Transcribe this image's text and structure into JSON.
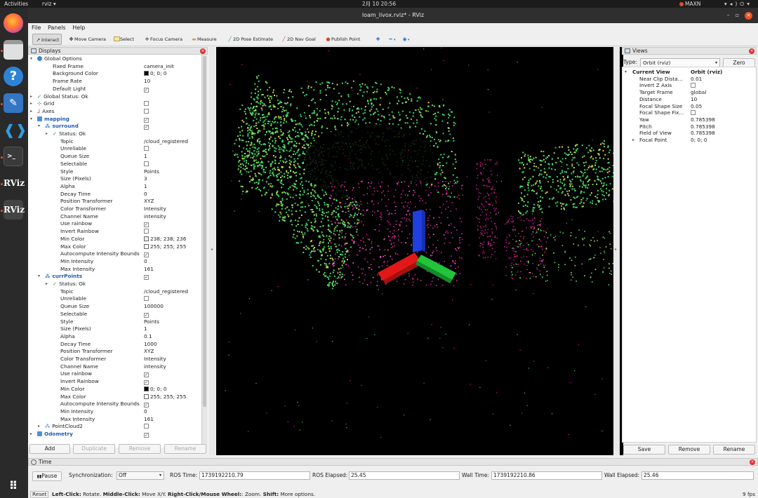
{
  "system": {
    "activities": "Activities",
    "app_menu": "rviz ▾",
    "clock": "2月 10  20:56",
    "power_mode": "MAXN",
    "tray_icons": [
      "wifi-icon",
      "volume-icon",
      "power-icon"
    ]
  },
  "dock": {
    "items": [
      "firefox-icon",
      "files-icon",
      "help-icon",
      "text-editor-icon",
      "vscode-icon",
      "terminal-icon",
      "rviz-icon",
      "rviz-icon",
      "show-apps-icon"
    ],
    "rviz_label": "RViz"
  },
  "window": {
    "title": "loam_livox.rviz* - RViz",
    "controls": [
      "minimize",
      "maximize",
      "close"
    ]
  },
  "menu": [
    "File",
    "Panels",
    "Help"
  ],
  "toolbar": [
    {
      "label": "Interact",
      "icon": "cursor-icon",
      "active": true
    },
    {
      "label": "Move Camera",
      "icon": "move-camera-icon"
    },
    {
      "label": "Select",
      "icon": "select-icon"
    },
    {
      "label": "Focus Camera",
      "icon": "focus-camera-icon"
    },
    {
      "label": "Measure",
      "icon": "measure-icon"
    },
    {
      "label": "2D Pose Estimate",
      "icon": "pose-arrow-icon"
    },
    {
      "label": "2D Nav Goal",
      "icon": "nav-goal-icon"
    },
    {
      "label": "Publish Point",
      "icon": "publish-point-icon"
    },
    {
      "label": "",
      "icon": "plus-icon"
    },
    {
      "label": "",
      "icon": "minus-icon"
    },
    {
      "label": "",
      "icon": "eye-icon"
    }
  ],
  "displays": {
    "title": "Displays",
    "rows": [
      {
        "name": "Global Options",
        "value": "",
        "lvl": 0,
        "arrow": "open",
        "icon": "globe",
        "cb": null
      },
      {
        "name": "Fixed Frame",
        "value": "camera_init",
        "lvl": 2
      },
      {
        "name": "Background Color",
        "value": "0; 0; 0",
        "lvl": 2,
        "swatch": "#000000"
      },
      {
        "name": "Frame Rate",
        "value": "10",
        "lvl": 2
      },
      {
        "name": "Default Light",
        "value": "",
        "lvl": 2,
        "cb": true
      },
      {
        "name": "Global Status: Ok",
        "value": "",
        "lvl": 0,
        "arrow": "closed",
        "icon": "check"
      },
      {
        "name": "Grid",
        "value": "",
        "lvl": 0,
        "arrow": "closed",
        "icon": "grid",
        "cb": false
      },
      {
        "name": "Axes",
        "value": "",
        "lvl": 0,
        "arrow": "closed",
        "icon": "axes",
        "cb": false
      },
      {
        "name": "mapping",
        "value": "",
        "lvl": 0,
        "arrow": "open",
        "icon": "folder",
        "cb": true,
        "blue": true
      },
      {
        "name": "surround",
        "value": "",
        "lvl": 1,
        "arrow": "open",
        "icon": "points",
        "cb": true,
        "blue": true
      },
      {
        "name": "Status: Ok",
        "value": "",
        "lvl": 2,
        "arrow": "closed",
        "icon": "check"
      },
      {
        "name": "Topic",
        "value": "/cloud_registered",
        "lvl": 3
      },
      {
        "name": "Unreliable",
        "value": "",
        "lvl": 3,
        "cb": false
      },
      {
        "name": "Queue Size",
        "value": "1",
        "lvl": 3
      },
      {
        "name": "Selectable",
        "value": "",
        "lvl": 3,
        "cb": false
      },
      {
        "name": "Style",
        "value": "Points",
        "lvl": 3
      },
      {
        "name": "Size (Pixels)",
        "value": "3",
        "lvl": 3
      },
      {
        "name": "Alpha",
        "value": "1",
        "lvl": 3
      },
      {
        "name": "Decay Time",
        "value": "0",
        "lvl": 3
      },
      {
        "name": "Position Transformer",
        "value": "XYZ",
        "lvl": 3
      },
      {
        "name": "Color Transformer",
        "value": "Intensity",
        "lvl": 3
      },
      {
        "name": "Channel Name",
        "value": "intensity",
        "lvl": 3
      },
      {
        "name": "Use rainbow",
        "value": "",
        "lvl": 3,
        "cb": true
      },
      {
        "name": "Invert Rainbow",
        "value": "",
        "lvl": 3,
        "cb": false
      },
      {
        "name": "Min Color",
        "value": "238; 238; 236",
        "lvl": 3,
        "swatch": "#eeeeec"
      },
      {
        "name": "Max Color",
        "value": "255; 255; 255",
        "lvl": 3,
        "swatch": "#ffffff"
      },
      {
        "name": "Autocompute Intensity Bounds",
        "value": "",
        "lvl": 3,
        "cb": true
      },
      {
        "name": "Min Intensity",
        "value": "0",
        "lvl": 3
      },
      {
        "name": "Max Intensity",
        "value": "161",
        "lvl": 3
      },
      {
        "name": "currPoints",
        "value": "",
        "lvl": 1,
        "arrow": "open",
        "icon": "points",
        "cb": true,
        "blue": true
      },
      {
        "name": "Status: Ok",
        "value": "",
        "lvl": 2,
        "arrow": "closed",
        "icon": "check"
      },
      {
        "name": "Topic",
        "value": "/cloud_registered",
        "lvl": 3
      },
      {
        "name": "Unreliable",
        "value": "",
        "lvl": 3,
        "cb": false
      },
      {
        "name": "Queue Size",
        "value": "100000",
        "lvl": 3
      },
      {
        "name": "Selectable",
        "value": "",
        "lvl": 3,
        "cb": true
      },
      {
        "name": "Style",
        "value": "Points",
        "lvl": 3
      },
      {
        "name": "Size (Pixels)",
        "value": "1",
        "lvl": 3
      },
      {
        "name": "Alpha",
        "value": "0.1",
        "lvl": 3
      },
      {
        "name": "Decay Time",
        "value": "1000",
        "lvl": 3
      },
      {
        "name": "Position Transformer",
        "value": "XYZ",
        "lvl": 3
      },
      {
        "name": "Color Transformer",
        "value": "Intensity",
        "lvl": 3
      },
      {
        "name": "Channel Name",
        "value": "intensity",
        "lvl": 3
      },
      {
        "name": "Use rainbow",
        "value": "",
        "lvl": 3,
        "cb": true
      },
      {
        "name": "Invert Rainbow",
        "value": "",
        "lvl": 3,
        "cb": true
      },
      {
        "name": "Min Color",
        "value": "0; 0; 0",
        "lvl": 3,
        "swatch": "#000000"
      },
      {
        "name": "Max Color",
        "value": "255; 255; 255",
        "lvl": 3,
        "swatch": "#ffffff"
      },
      {
        "name": "Autocompute Intensity Bounds",
        "value": "",
        "lvl": 3,
        "cb": true
      },
      {
        "name": "Min Intensity",
        "value": "0",
        "lvl": 3
      },
      {
        "name": "Max Intensity",
        "value": "161",
        "lvl": 3
      },
      {
        "name": "PointCloud2",
        "value": "",
        "lvl": 1,
        "arrow": "closed",
        "icon": "points",
        "cb": false
      },
      {
        "name": "Odometry",
        "value": "",
        "lvl": 0,
        "arrow": "closed",
        "icon": "folder",
        "cb": true,
        "blue": true
      }
    ],
    "buttons": [
      {
        "label": "Add",
        "enabled": true
      },
      {
        "label": "Duplicate",
        "enabled": false
      },
      {
        "label": "Remove",
        "enabled": false
      },
      {
        "label": "Rename",
        "enabled": false
      }
    ]
  },
  "views": {
    "title": "Views",
    "type_label": "Type:",
    "type_value": "Orbit (rviz)",
    "zero_label": "Zero",
    "rows": [
      {
        "name": "Current View",
        "value": "Orbit (rviz)",
        "head": true
      },
      {
        "name": "Near Clip Dista...",
        "value": "0.01"
      },
      {
        "name": "Invert Z Axis",
        "value": "",
        "cb": false
      },
      {
        "name": "Target Frame",
        "value": "global"
      },
      {
        "name": "Distance",
        "value": "10"
      },
      {
        "name": "Focal Shape Size",
        "value": "0.05"
      },
      {
        "name": "Focal Shape Fix...",
        "value": "",
        "cb": false
      },
      {
        "name": "Yaw",
        "value": "0.785398"
      },
      {
        "name": "Pitch",
        "value": "0.785398"
      },
      {
        "name": "Field of View",
        "value": "0.785398"
      },
      {
        "name": "Focal Point",
        "value": "0; 0; 0",
        "arrow": "closed"
      }
    ],
    "buttons": [
      "Save",
      "Remove",
      "Rename"
    ]
  },
  "time": {
    "title": "Time",
    "pause_label": "Pause",
    "sync_label": "Synchronization:",
    "sync_value": "Off",
    "ros_time_label": "ROS Time:",
    "ros_time": "1739192210.79",
    "ros_elapsed_label": "ROS Elapsed:",
    "ros_elapsed": "25.45",
    "wall_time_label": "Wall Time:",
    "wall_time": "1739192210.86",
    "wall_elapsed_label": "Wall Elapsed:",
    "wall_elapsed": "25.46"
  },
  "status": {
    "reset_label": "Reset",
    "hint_parts": [
      {
        "text": "Left-Click:",
        "bold": true
      },
      {
        "text": " Rotate. ",
        "bold": false
      },
      {
        "text": "Middle-Click:",
        "bold": true
      },
      {
        "text": " Move X/Y. ",
        "bold": false
      },
      {
        "text": "Right-Click/Mouse Wheel:",
        "bold": true
      },
      {
        "text": ": Zoom. ",
        "bold": false
      },
      {
        "text": "Shift:",
        "bold": true
      },
      {
        "text": " More options.",
        "bold": false
      }
    ],
    "fps": "9 fps"
  },
  "colors": {
    "accent_blue": "#2159b5",
    "close_red": "#e95420",
    "cloud_green": "#3ddc6a",
    "cloud_magenta": "#e0209a",
    "axis_x": "#e01818",
    "axis_y": "#21c43a",
    "axis_z": "#1f3fe0"
  }
}
